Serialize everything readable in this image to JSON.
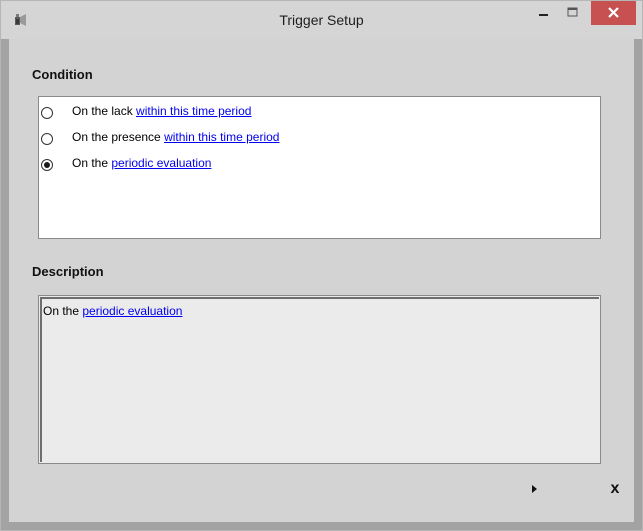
{
  "window": {
    "title": "Trigger Setup",
    "icons": {
      "app": "speaker-icon",
      "minimize": "minimize-icon",
      "maximize": "maximize-icon",
      "close": "close-icon"
    },
    "colors": {
      "close_button": "#c75050",
      "client": "#d3d3d3",
      "link": "#0000ee"
    }
  },
  "condition": {
    "heading": "Condition",
    "options": [
      {
        "prefix": "On the lack",
        "link": "within this time period",
        "checked": false
      },
      {
        "prefix": "On the presence",
        "link": "within this time period",
        "checked": false
      },
      {
        "prefix": "On the",
        "link": "periodic evaluation",
        "checked": true
      }
    ]
  },
  "description": {
    "heading": "Description",
    "prefix": "On the",
    "link": "periodic evaluation"
  },
  "footer": {
    "next_icon": "play-arrow-icon",
    "close_label": "x"
  }
}
